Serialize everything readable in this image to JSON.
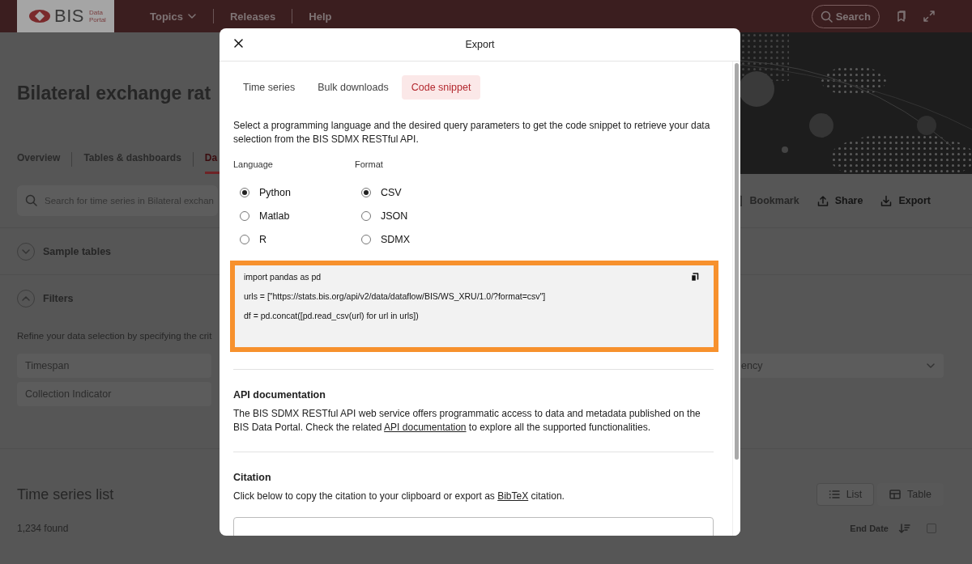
{
  "header": {
    "logo": {
      "name": "BIS",
      "sub_top": "Data",
      "sub_bottom": "Portal"
    },
    "nav": [
      {
        "label": "Topics",
        "kind": "dropdown"
      },
      {
        "label": "Releases",
        "kind": "link"
      },
      {
        "label": "Help",
        "kind": "link"
      }
    ],
    "search_button": "Search"
  },
  "page": {
    "title": "Bilateral exchange rat",
    "tabs": [
      {
        "label": "Overview",
        "selected": false
      },
      {
        "label": "Tables & dashboards",
        "selected": false
      },
      {
        "label": "Da",
        "selected": true
      }
    ],
    "search": {
      "placeholder": "Search for time series in Bilateral exchan"
    },
    "actions": [
      {
        "label": "Bookmark",
        "kind": "bookmark",
        "disabled": true
      },
      {
        "label": "Share",
        "kind": "share",
        "disabled": false
      },
      {
        "label": "Export",
        "kind": "export",
        "disabled": false
      }
    ],
    "sections": [
      {
        "label": "Sample tables",
        "expanded": false
      },
      {
        "label": "Filters",
        "expanded": true
      }
    ],
    "filter_hint": "Refine your data selection by specifying the crit",
    "filters_left": [
      "Timespan",
      "Collection Indicator"
    ],
    "filters_right": [
      "ency"
    ],
    "list": {
      "title": "Time series list",
      "count": "1,234 found",
      "views": [
        {
          "label": "List",
          "kind": "list",
          "selected": true
        },
        {
          "label": "Table",
          "kind": "table",
          "selected": false
        }
      ],
      "sort": "End Date",
      "select_all": {
        "checked": false
      }
    }
  },
  "modal": {
    "title": "Export",
    "tabs": [
      {
        "label": "Time series",
        "selected": false
      },
      {
        "label": "Bulk downloads",
        "selected": false
      },
      {
        "label": "Code snippet",
        "selected": true
      }
    ],
    "intro": "Select a programming language and the desired query parameters to get the code snippet to retrieve your data selection from the BIS SDMX RESTful API.",
    "language": {
      "label": "Language",
      "options": [
        {
          "label": "Python",
          "selected": true
        },
        {
          "label": "Matlab",
          "selected": false
        },
        {
          "label": "R",
          "selected": false
        }
      ]
    },
    "format": {
      "label": "Format",
      "options": [
        {
          "label": "CSV",
          "selected": true
        },
        {
          "label": "JSON",
          "selected": false
        },
        {
          "label": "SDMX",
          "selected": false
        }
      ]
    },
    "code": [
      "import pandas as pd",
      "urls = [\"https://stats.bis.org/api/v2/data/dataflow/BIS/WS_XRU/1.0/?format=csv\"]",
      "df = pd.concat([pd.read_csv(url) for url in urls])"
    ],
    "sections": [
      {
        "heading": "API documentation",
        "before": "The BIS SDMX RESTful API web service offers programmatic access to data and metadata published on the BIS Data Portal. Check the related ",
        "link": "API documentation",
        "after": " to explore all the supported functionalities."
      },
      {
        "heading": "Citation",
        "before": "Click below to copy the citation to your clipboard or export as ",
        "link": "BibTeX",
        "after": " citation."
      }
    ]
  }
}
